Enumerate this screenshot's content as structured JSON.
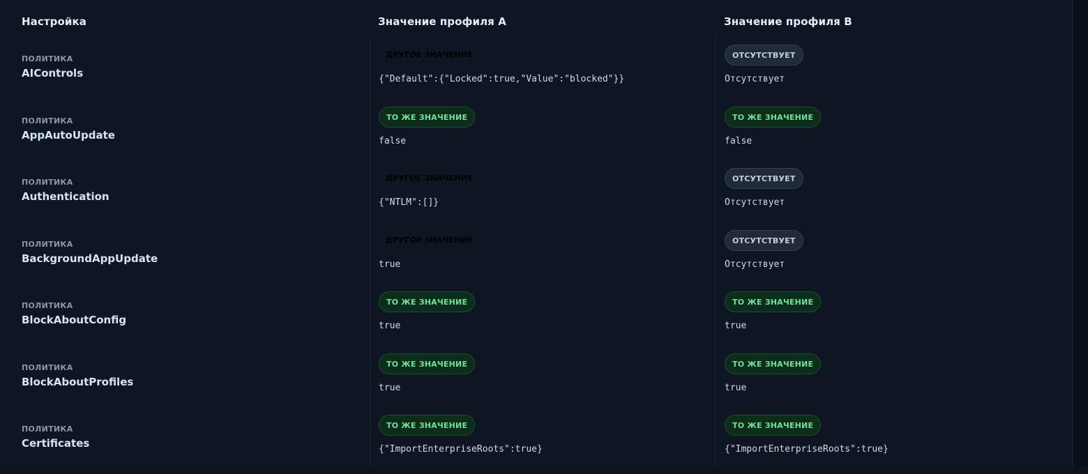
{
  "header": {
    "setting": "Настройка",
    "profile_a": "Значение профиля A",
    "profile_b": "Значение профиля B"
  },
  "colors": {
    "different": "#f4b14a",
    "same": "#6ee29a",
    "absent": "#c5cedb"
  },
  "rows": [
    {
      "kind": "ПОЛИТИКА",
      "name": "AIControls",
      "a": {
        "status": "different",
        "badge": "ДРУГОЕ ЗНАЧЕНИЕ",
        "value": "{\"Default\":{\"Locked\":true,\"Value\":\"blocked\"}}"
      },
      "b": {
        "status": "absent",
        "badge": "ОТСУТСТВУЕТ",
        "value": "Отсутствует"
      }
    },
    {
      "kind": "ПОЛИТИКА",
      "name": "AppAutoUpdate",
      "a": {
        "status": "same",
        "badge": "ТО ЖЕ ЗНАЧЕНИЕ",
        "value": "false"
      },
      "b": {
        "status": "same",
        "badge": "ТО ЖЕ ЗНАЧЕНИЕ",
        "value": "false"
      }
    },
    {
      "kind": "ПОЛИТИКА",
      "name": "Authentication",
      "a": {
        "status": "different",
        "badge": "ДРУГОЕ ЗНАЧЕНИЕ",
        "value": "{\"NTLM\":[]}"
      },
      "b": {
        "status": "absent",
        "badge": "ОТСУТСТВУЕТ",
        "value": "Отсутствует"
      }
    },
    {
      "kind": "ПОЛИТИКА",
      "name": "BackgroundAppUpdate",
      "a": {
        "status": "different",
        "badge": "ДРУГОЕ ЗНАЧЕНИЕ",
        "value": "true"
      },
      "b": {
        "status": "absent",
        "badge": "ОТСУТСТВУЕТ",
        "value": "Отсутствует"
      }
    },
    {
      "kind": "ПОЛИТИКА",
      "name": "BlockAboutConfig",
      "a": {
        "status": "same",
        "badge": "ТО ЖЕ ЗНАЧЕНИЕ",
        "value": "true"
      },
      "b": {
        "status": "same",
        "badge": "ТО ЖЕ ЗНАЧЕНИЕ",
        "value": "true"
      }
    },
    {
      "kind": "ПОЛИТИКА",
      "name": "BlockAboutProfiles",
      "a": {
        "status": "same",
        "badge": "ТО ЖЕ ЗНАЧЕНИЕ",
        "value": "true"
      },
      "b": {
        "status": "same",
        "badge": "ТО ЖЕ ЗНАЧЕНИЕ",
        "value": "true"
      }
    },
    {
      "kind": "ПОЛИТИКА",
      "name": "Certificates",
      "a": {
        "status": "same",
        "badge": "ТО ЖЕ ЗНАЧЕНИЕ",
        "value": "{\"ImportEnterpriseRoots\":true}"
      },
      "b": {
        "status": "same",
        "badge": "ТО ЖЕ ЗНАЧЕНИЕ",
        "value": "{\"ImportEnterpriseRoots\":true}"
      }
    }
  ]
}
